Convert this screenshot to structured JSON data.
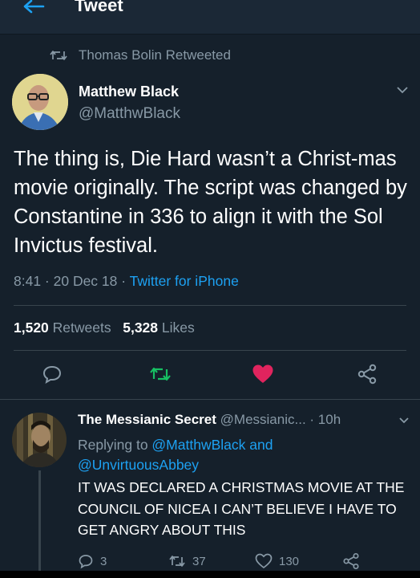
{
  "header": {
    "title": "Tweet",
    "back_icon": "arrow-left-icon"
  },
  "retweeted_by": {
    "text": "Thomas Bolin Retweeted",
    "icon": "retweet-icon"
  },
  "tweet": {
    "author_name": "Matthew Black",
    "author_handle": "@MatthwBlack",
    "text": "The thing is, Die Hard wasn’t a Christ-mas movie originally. The script was changed by Constantine in 336 to align it with the Sol Invictus festival.",
    "time_date": "8:41 · 20 Dec 18 · ",
    "source": "Twitter for iPhone",
    "retweets_count": "1,520",
    "retweets_label": "Retweets",
    "likes_count": "5,328",
    "likes_label": "Likes",
    "liked": true
  },
  "reply": {
    "author_name": "The Messianic Secret",
    "author_handle": "@Messianic...",
    "time": "· 10h",
    "replying_prefix": "Replying to ",
    "replying_to_1": "@MatthwBlack",
    "replying_and": " and",
    "replying_to_2": "@UnvirtuousAbbey",
    "text": "IT WAS DECLARED A CHRISTMAS MOVIE AT THE COUNCIL OF NICEA I CAN’T BELIEVE I HAVE TO GET ANGRY ABOUT THIS",
    "reply_count": "3",
    "retweet_count": "37",
    "like_count": "130"
  },
  "colors": {
    "background": "#15202b",
    "accent_link": "#1da1f2",
    "muted": "#8899a6",
    "like_active": "#e0245e",
    "retweet_green": "#17bf63"
  }
}
